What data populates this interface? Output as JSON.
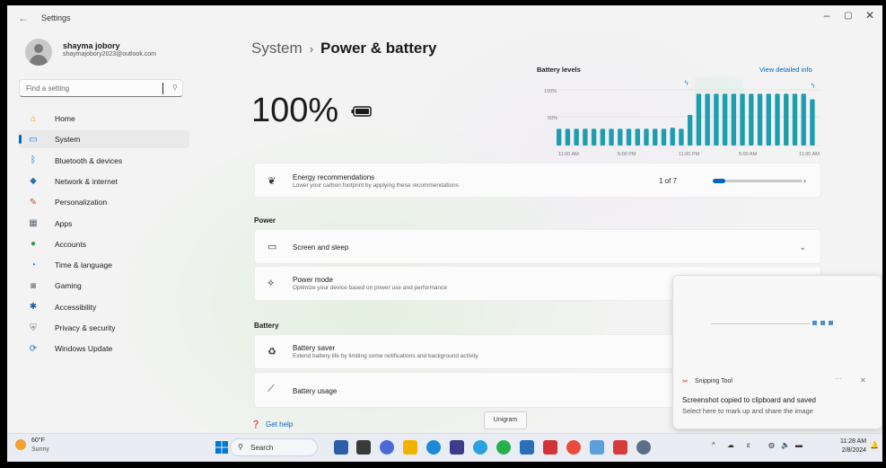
{
  "window": {
    "title": "Settings",
    "back_icon": "back-arrow-icon"
  },
  "profile": {
    "name": "shayma jobory",
    "email": "shaymajobory2023@outlook.com"
  },
  "search": {
    "placeholder": "Find a setting"
  },
  "sidebar": {
    "items": [
      {
        "label": "Home",
        "icon": "home-icon",
        "color": "#e8a000"
      },
      {
        "label": "System",
        "icon": "system-icon",
        "color": "#0078d4",
        "selected": true
      },
      {
        "label": "Bluetooth & devices",
        "icon": "bluetooth-icon",
        "color": "#0078d4"
      },
      {
        "label": "Network & internet",
        "icon": "wifi-icon",
        "color": "#2f6fb6"
      },
      {
        "label": "Personalization",
        "icon": "brush-icon",
        "color": "#c45a1c"
      },
      {
        "label": "Apps",
        "icon": "apps-icon",
        "color": "#5a6a7a"
      },
      {
        "label": "Accounts",
        "icon": "accounts-icon",
        "color": "#2f9e44"
      },
      {
        "label": "Time & language",
        "icon": "globe-clock-icon",
        "color": "#1f7bd0"
      },
      {
        "label": "Gaming",
        "icon": "controller-icon",
        "color": "#808890"
      },
      {
        "label": "Accessibility",
        "icon": "accessibility-icon",
        "color": "#1b5fa8"
      },
      {
        "label": "Privacy & security",
        "icon": "shield-icon",
        "color": "#7a7f86"
      },
      {
        "label": "Windows Update",
        "icon": "update-icon",
        "color": "#0078d4"
      }
    ]
  },
  "breadcrumb": {
    "parent": "System",
    "separator": "›",
    "current": "Power & battery"
  },
  "battery": {
    "percent_text": "100%",
    "level": 1.0
  },
  "battery_levels": {
    "title": "Battery levels",
    "link": "View detailed info",
    "y_ticks": [
      "100%",
      "50%"
    ],
    "x_ticks": [
      "11:00 AM",
      "5:00 PM",
      "11:00 PM",
      "5:00 AM",
      "11:00 AM"
    ],
    "bars": [
      0.3,
      0.3,
      0.3,
      0.3,
      0.3,
      0.3,
      0.3,
      0.3,
      0.3,
      0.3,
      0.3,
      0.3,
      0.3,
      0.32,
      0.3,
      0.55,
      0.93,
      0.93,
      0.93,
      0.93,
      0.93,
      0.93,
      0.93,
      0.93,
      0.93,
      0.93,
      0.93,
      0.93,
      0.93,
      0.83
    ],
    "bar_color": "#1e9cb0"
  },
  "energy": {
    "title": "Energy recommendations",
    "subtitle": "Lower your carbon footprint by applying these recommendations",
    "count": "1 of 7",
    "progress": 0.14
  },
  "sections": {
    "power": "Power",
    "battery": "Battery"
  },
  "rows": {
    "screen_sleep": {
      "title": "Screen and sleep"
    },
    "power_mode": {
      "title": "Power mode",
      "subtitle": "Optimize your device based on power use and performance"
    },
    "battery_saver": {
      "title": "Battery saver",
      "subtitle": "Extend battery life by limiting some notifications and background activity"
    },
    "battery_usage": {
      "title": "Battery usage"
    }
  },
  "get_help": "Get help",
  "tooltip": "Unigram",
  "toast": {
    "app": "Snipping Tool",
    "message": "Screenshot copied to clipboard and saved",
    "action": "Select here to mark up and share the image"
  },
  "taskbar": {
    "weather_temp": "60°F",
    "weather_cond": "Sunny",
    "search": "Search",
    "time": "11:28 AM",
    "date": "2/8/2024"
  }
}
